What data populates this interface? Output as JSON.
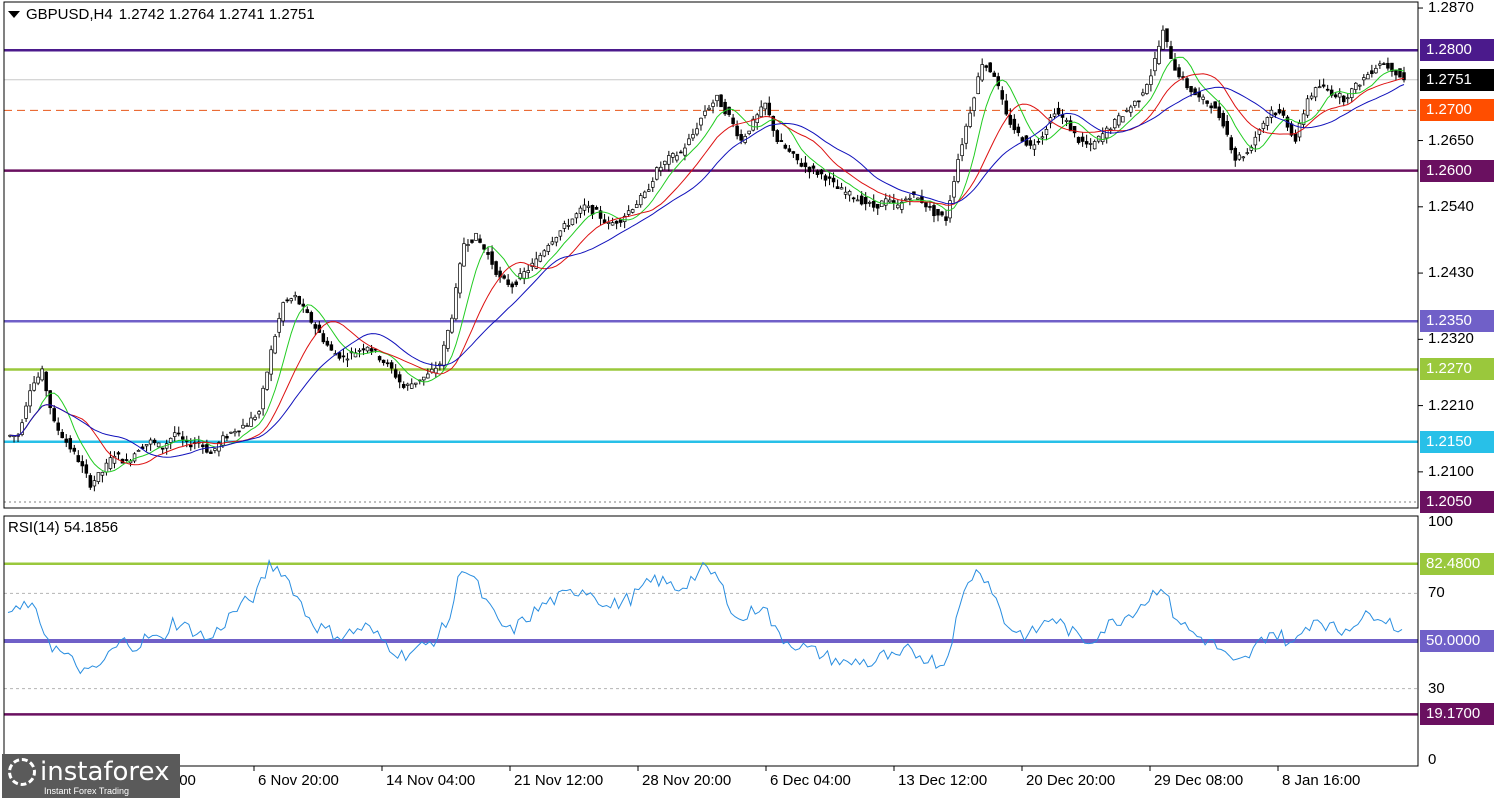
{
  "window": {
    "symbol_title": "GBPUSD,H4",
    "ohlc": "1.2742 1.2764 1.2741 1.2751",
    "collapse_icon": "triangle-down-icon"
  },
  "rsi_panel": {
    "title": "RSI(14) 54.1856"
  },
  "price_axis": {
    "ticks": [
      {
        "label": "1.2870",
        "value": 1.287
      },
      {
        "label": "1.2650",
        "value": 1.265
      },
      {
        "label": "1.2540",
        "value": 1.254
      },
      {
        "label": "1.2430",
        "value": 1.243
      },
      {
        "label": "1.2320",
        "value": 1.232
      },
      {
        "label": "1.2210",
        "value": 1.221
      },
      {
        "label": "1.2100",
        "value": 1.21
      }
    ],
    "range": [
      1.204,
      1.288
    ]
  },
  "levels": [
    {
      "label": "1.2800",
      "value": 1.28,
      "color": "#4b1a8c",
      "tag_bg": "#4b1a8c",
      "tag_fg": "#ffffff",
      "style": "solid"
    },
    {
      "label": "1.2751",
      "value": 1.2751,
      "color": "#c8c8c8",
      "tag_bg": "#000000",
      "tag_fg": "#ffffff",
      "style": "thin",
      "current": true
    },
    {
      "label": "1.2700",
      "value": 1.27,
      "color": "#e8581a",
      "tag_bg": "#ff4e00",
      "tag_fg": "#ffffff",
      "style": "dashed"
    },
    {
      "label": "1.2600",
      "value": 1.26,
      "color": "#6a1060",
      "tag_bg": "#6a1060",
      "tag_fg": "#ffffff",
      "style": "solid"
    },
    {
      "label": "1.2350",
      "value": 1.235,
      "color": "#7060c8",
      "tag_bg": "#7060c8",
      "tag_fg": "#ffffff",
      "style": "solid"
    },
    {
      "label": "1.2270",
      "value": 1.227,
      "color": "#9ac83c",
      "tag_bg": "#9ac83c",
      "tag_fg": "#ffffff",
      "style": "solid"
    },
    {
      "label": "1.2150",
      "value": 1.215,
      "color": "#28c0e8",
      "tag_bg": "#28c0e8",
      "tag_fg": "#ffffff",
      "style": "solid"
    },
    {
      "label": "1.2050",
      "value": 1.205,
      "color": "#808080",
      "tag_bg": "#6a1060",
      "tag_fg": "#ffffff",
      "style": "dotted"
    }
  ],
  "rsi_axis": {
    "ticks": [
      {
        "label": "100",
        "value": 100
      },
      {
        "label": "70",
        "value": 70
      },
      {
        "label": "30",
        "value": 30
      },
      {
        "label": "0",
        "value": 0
      }
    ],
    "levels": [
      {
        "label": "82.4800",
        "value": 82.48,
        "color": "#9ac83c",
        "tag_bg": "#9ac83c"
      },
      {
        "label": "50.0000",
        "value": 50.0,
        "color": "#7060c8",
        "tag_bg": "#7060c8"
      },
      {
        "label": "19.1700",
        "value": 19.17,
        "color": "#6a1060",
        "tag_bg": "#6a1060"
      }
    ]
  },
  "time_axis": [
    {
      "label": "31 Oct 12:00"
    },
    {
      "label": "6 Nov 20:00"
    },
    {
      "label": "14 Nov 04:00"
    },
    {
      "label": "21 Nov 12:00"
    },
    {
      "label": "28 Nov 20:00"
    },
    {
      "label": "6 Dec 04:00"
    },
    {
      "label": "13 Dec 12:00"
    },
    {
      "label": "20 Dec 20:00"
    },
    {
      "label": "29 Dec 08:00"
    },
    {
      "label": "8 Jan 16:00"
    }
  ],
  "logo": {
    "brand": "instaforex",
    "tagline": "Instant Forex Trading",
    "icon": "gear-icon"
  },
  "colors": {
    "bull_body": "#ffffff",
    "bear_body": "#000000",
    "wick": "#000000",
    "ma_fast": "#22cc22",
    "ma_mid": "#dd1111",
    "ma_slow": "#1111bb",
    "rsi_line": "#2a8ee0",
    "grid_dotted": "#b4b4b4"
  },
  "chart_data": {
    "type": "candlestick",
    "symbol": "GBPUSD",
    "timeframe": "H4",
    "close_series": [
      1.216,
      1.224,
      1.2265,
      1.218,
      1.215,
      1.212,
      1.208,
      1.21,
      1.213,
      1.2115,
      1.214,
      1.215,
      1.214,
      1.2165,
      1.2145,
      1.215,
      1.213,
      1.2155,
      1.217,
      1.218,
      1.22,
      1.23,
      1.238,
      1.239,
      1.236,
      1.233,
      1.23,
      1.229,
      1.23,
      1.231,
      1.229,
      1.227,
      1.224,
      1.225,
      1.226,
      1.228,
      1.236,
      1.248,
      1.249,
      1.246,
      1.242,
      1.241,
      1.243,
      1.245,
      1.248,
      1.25,
      1.252,
      1.254,
      1.253,
      1.251,
      1.252,
      1.254,
      1.256,
      1.26,
      1.262,
      1.263,
      1.266,
      1.27,
      1.272,
      1.269,
      1.265,
      1.268,
      1.271,
      1.265,
      1.263,
      1.261,
      1.26,
      1.259,
      1.257,
      1.256,
      1.255,
      1.254,
      1.255,
      1.254,
      1.256,
      1.255,
      1.253,
      1.252,
      1.262,
      1.27,
      1.278,
      1.276,
      1.269,
      1.266,
      1.264,
      1.266,
      1.27,
      1.268,
      1.265,
      1.264,
      1.266,
      1.268,
      1.27,
      1.272,
      1.276,
      1.283,
      1.277,
      1.274,
      1.272,
      1.271,
      1.268,
      1.262,
      1.263,
      1.267,
      1.27,
      1.269,
      1.265,
      1.272,
      1.274,
      1.273,
      1.272,
      1.274,
      1.276,
      1.278,
      1.277,
      1.2751
    ],
    "rsi_series": [
      62,
      66,
      58,
      48,
      44,
      40,
      36,
      40,
      46,
      50,
      48,
      52,
      50,
      58,
      56,
      54,
      50,
      56,
      62,
      66,
      70,
      82,
      80,
      72,
      62,
      56,
      54,
      52,
      54,
      56,
      52,
      48,
      44,
      46,
      48,
      52,
      60,
      82,
      76,
      66,
      58,
      54,
      58,
      62,
      66,
      68,
      70,
      72,
      70,
      64,
      66,
      68,
      72,
      76,
      74,
      72,
      76,
      80,
      78,
      68,
      58,
      62,
      66,
      54,
      50,
      48,
      46,
      44,
      42,
      40,
      42,
      40,
      44,
      42,
      46,
      44,
      42,
      40,
      58,
      76,
      80,
      72,
      58,
      54,
      52,
      56,
      60,
      56,
      52,
      50,
      54,
      58,
      60,
      64,
      68,
      74,
      62,
      56,
      52,
      50,
      46,
      40,
      42,
      48,
      54,
      52,
      48,
      56,
      60,
      56,
      54,
      58,
      60,
      62,
      58,
      54.19
    ],
    "price_range": [
      1.204,
      1.288
    ],
    "rsi_range": [
      0,
      100
    ]
  }
}
